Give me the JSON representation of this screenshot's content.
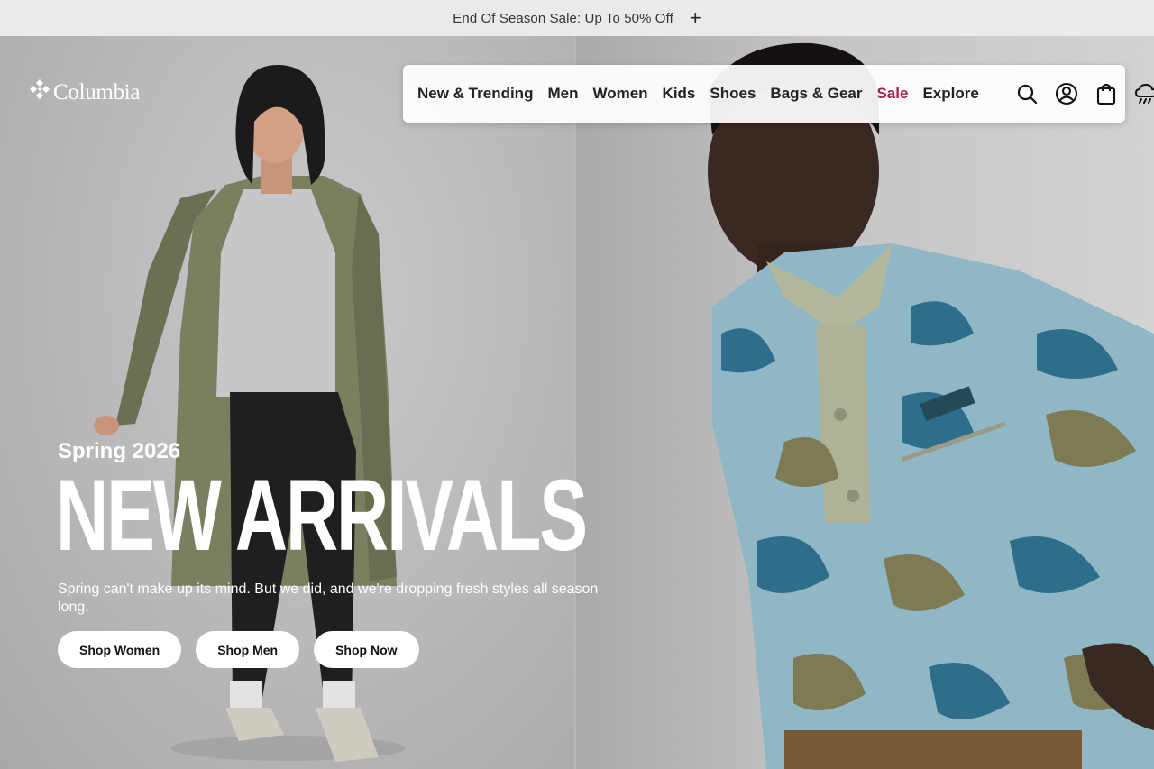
{
  "promo": {
    "text": "End Of Season Sale: Up To 50% Off",
    "expand_icon": "plus-icon"
  },
  "brand": {
    "name": "Columbia",
    "logo_icon": "columbia-diamond-logo-icon"
  },
  "nav": {
    "items": [
      {
        "label": "New & Trending"
      },
      {
        "label": "Men"
      },
      {
        "label": "Women"
      },
      {
        "label": "Kids"
      },
      {
        "label": "Shoes"
      },
      {
        "label": "Bags & Gear"
      },
      {
        "label": "Sale",
        "color": "#a81e45"
      },
      {
        "label": "Explore"
      }
    ],
    "icons": [
      "search-icon",
      "account-icon",
      "shopping-bag-icon",
      "weather-icon"
    ]
  },
  "hero": {
    "eyebrow": "Spring 2026",
    "title": "NEW ARRIVALS",
    "description": "Spring can't make up its mind. But we did, and we're dropping fresh styles all season long.",
    "ctas": [
      {
        "label": "Shop Women"
      },
      {
        "label": "Shop Men"
      },
      {
        "label": "Shop Now"
      }
    ]
  },
  "colors": {
    "promo_bg": "#e9ebea",
    "sale_accent": "#a81e45",
    "cta_bg": "#ffffff"
  }
}
